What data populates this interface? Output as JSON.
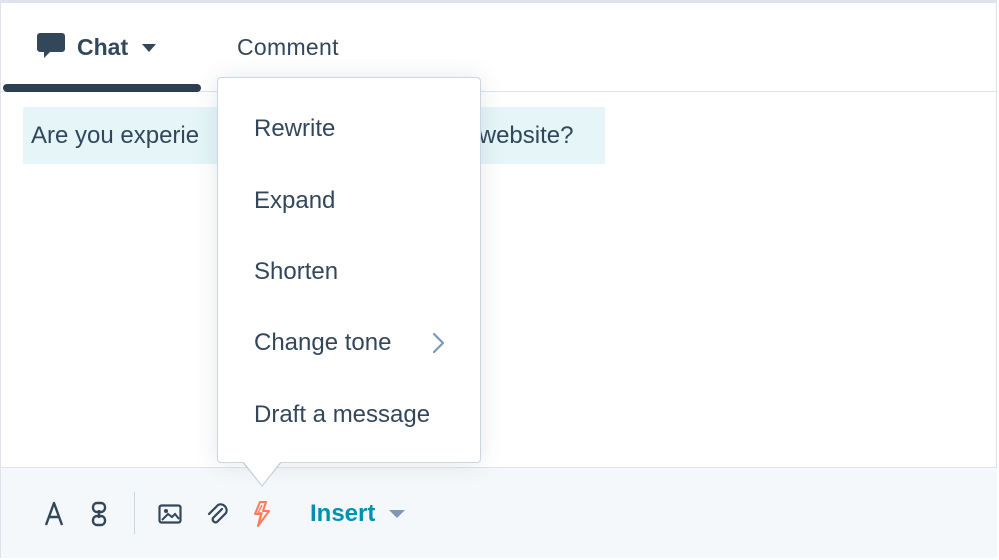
{
  "tabs": {
    "chat_label": "Chat",
    "comment_label": "Comment"
  },
  "message": {
    "text_left": "Are you experie",
    "text_right": "r website?"
  },
  "menu": {
    "items": [
      {
        "label": "Rewrite",
        "icon": "none"
      },
      {
        "label": "Expand",
        "icon": "none"
      },
      {
        "label": "Shorten",
        "icon": "none"
      },
      {
        "label": "Change tone",
        "icon": "chevron-right-icon"
      },
      {
        "label": "Draft a message",
        "icon": "none"
      }
    ]
  },
  "toolbar": {
    "icons": [
      "text-format-icon",
      "link-icon",
      "image-icon",
      "attachment-icon",
      "ai-assistant-icon"
    ],
    "insert_label": "Insert"
  },
  "colors": {
    "text": "#33475b",
    "accent": "#0091ae",
    "ai_orange": "#ff7a59",
    "highlight": "#e5f5f8",
    "tab_underline": "#2d3e50"
  }
}
